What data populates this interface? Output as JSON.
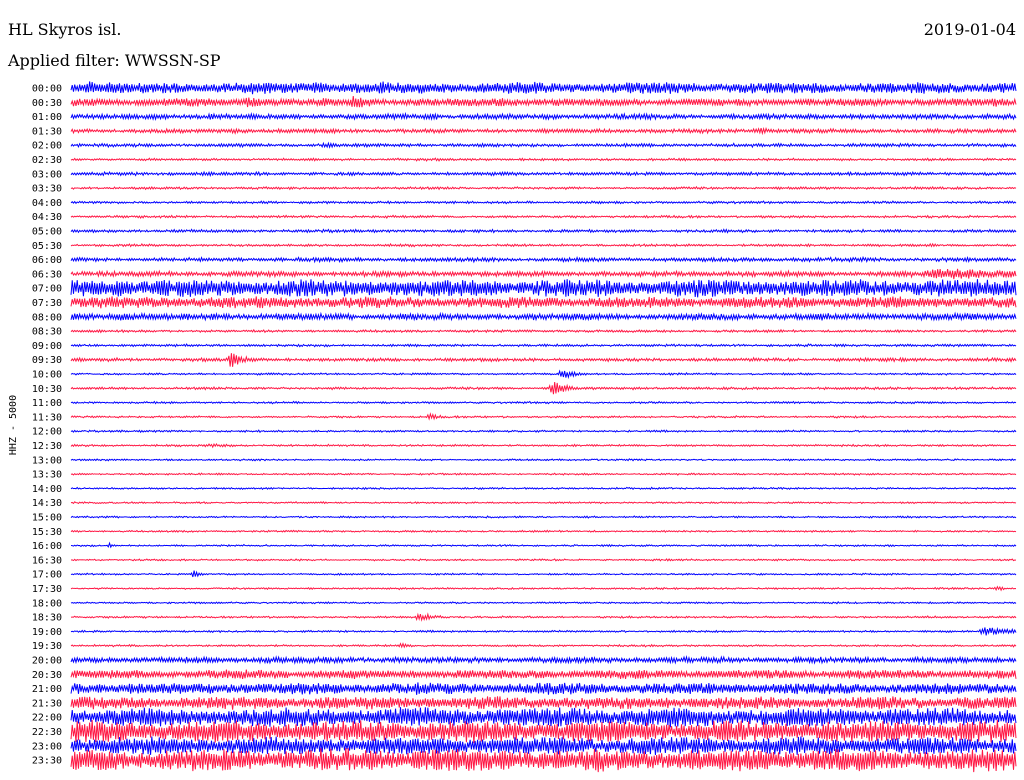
{
  "header": {
    "station": "HL Skyros isl.",
    "date": "2019-01-04",
    "filter": "Applied filter: WWSSN-SP"
  },
  "chart_data": {
    "type": "line",
    "title": "HL Skyros isl.",
    "subtitle": "Applied filter: WWSSN-SP",
    "date": "2019-01-04",
    "ylabel": "HHZ - 5000",
    "colors": [
      "#0000ff",
      "#ff1744"
    ],
    "rows": [
      {
        "label": "00:00",
        "amplitude": 0.45,
        "events": [
          {
            "at": 0.02,
            "amp": 0.7,
            "dur": 0.03
          },
          {
            "at": 0.26,
            "amp": 0.55,
            "dur": 0.05
          },
          {
            "at": 0.33,
            "amp": 0.6,
            "dur": 0.05
          }
        ]
      },
      {
        "label": "00:30",
        "amplitude": 0.3,
        "events": [
          {
            "at": 0.19,
            "amp": 0.45,
            "dur": 0.04
          },
          {
            "at": 0.3,
            "amp": 0.6,
            "dur": 0.03
          },
          {
            "at": 0.45,
            "amp": 0.45,
            "dur": 0.06
          },
          {
            "at": 0.98,
            "amp": 0.45,
            "dur": 0.03
          }
        ]
      },
      {
        "label": "01:00",
        "amplitude": 0.2,
        "events": [
          {
            "at": 0.15,
            "amp": 0.3,
            "dur": 0.03
          },
          {
            "at": 0.38,
            "amp": 0.3,
            "dur": 0.03
          }
        ]
      },
      {
        "label": "01:30",
        "amplitude": 0.15,
        "events": [
          {
            "at": 0.17,
            "amp": 0.25,
            "dur": 0.03
          },
          {
            "at": 0.73,
            "amp": 0.25,
            "dur": 0.04
          }
        ]
      },
      {
        "label": "02:00",
        "amplitude": 0.12,
        "events": [
          {
            "at": 0.27,
            "amp": 0.2,
            "dur": 0.04
          }
        ]
      },
      {
        "label": "02:30",
        "amplitude": 0.08,
        "events": []
      },
      {
        "label": "03:00",
        "amplitude": 0.12,
        "events": [
          {
            "at": 0.14,
            "amp": 0.2,
            "dur": 0.03
          }
        ]
      },
      {
        "label": "03:30",
        "amplitude": 0.08,
        "events": []
      },
      {
        "label": "04:00",
        "amplitude": 0.08,
        "events": []
      },
      {
        "label": "04:30",
        "amplitude": 0.08,
        "events": []
      },
      {
        "label": "05:00",
        "amplitude": 0.1,
        "events": []
      },
      {
        "label": "05:30",
        "amplitude": 0.08,
        "events": [
          {
            "at": 0.91,
            "amp": 0.35,
            "dur": 0.004
          }
        ]
      },
      {
        "label": "06:00",
        "amplitude": 0.15,
        "events": [
          {
            "at": 0.42,
            "amp": 0.2,
            "dur": 0.05
          }
        ]
      },
      {
        "label": "06:30",
        "amplitude": 0.2,
        "events": [
          {
            "at": 0.93,
            "amp": 0.55,
            "dur": 0.1
          }
        ]
      },
      {
        "label": "07:00",
        "amplitude": 0.7,
        "events": [
          {
            "at": 0.05,
            "amp": 0.8,
            "dur": 0.06
          }
        ]
      },
      {
        "label": "07:30",
        "amplitude": 0.45,
        "events": []
      },
      {
        "label": "08:00",
        "amplitude": 0.25,
        "events": [
          {
            "at": 0.05,
            "amp": 0.4,
            "dur": 0.05
          }
        ]
      },
      {
        "label": "08:30",
        "amplitude": 0.08,
        "events": []
      },
      {
        "label": "09:00",
        "amplitude": 0.08,
        "events": []
      },
      {
        "label": "09:30",
        "amplitude": 0.12,
        "events": [
          {
            "at": 0.17,
            "amp": 0.8,
            "dur": 0.012
          }
        ]
      },
      {
        "label": "10:00",
        "amplitude": 0.06,
        "events": [
          {
            "at": 0.52,
            "amp": 0.55,
            "dur": 0.012
          }
        ]
      },
      {
        "label": "10:30",
        "amplitude": 0.08,
        "events": [
          {
            "at": 0.51,
            "amp": 0.7,
            "dur": 0.015
          }
        ]
      },
      {
        "label": "11:00",
        "amplitude": 0.06,
        "events": []
      },
      {
        "label": "11:30",
        "amplitude": 0.06,
        "events": [
          {
            "at": 0.38,
            "amp": 0.3,
            "dur": 0.012
          }
        ]
      },
      {
        "label": "12:00",
        "amplitude": 0.06,
        "events": []
      },
      {
        "label": "12:30",
        "amplitude": 0.06,
        "events": [
          {
            "at": 0.15,
            "amp": 0.2,
            "dur": 0.02
          }
        ]
      },
      {
        "label": "13:00",
        "amplitude": 0.05,
        "events": []
      },
      {
        "label": "13:30",
        "amplitude": 0.05,
        "events": []
      },
      {
        "label": "14:00",
        "amplitude": 0.05,
        "events": []
      },
      {
        "label": "14:30",
        "amplitude": 0.05,
        "events": []
      },
      {
        "label": "15:00",
        "amplitude": 0.05,
        "events": []
      },
      {
        "label": "15:30",
        "amplitude": 0.05,
        "events": []
      },
      {
        "label": "16:00",
        "amplitude": 0.05,
        "events": [
          {
            "at": 0.04,
            "amp": 0.25,
            "dur": 0.006
          }
        ]
      },
      {
        "label": "16:30",
        "amplitude": 0.05,
        "events": []
      },
      {
        "label": "17:00",
        "amplitude": 0.05,
        "events": [
          {
            "at": 0.13,
            "amp": 0.35,
            "dur": 0.008
          }
        ]
      },
      {
        "label": "17:30",
        "amplitude": 0.05,
        "events": [
          {
            "at": 0.98,
            "amp": 0.2,
            "dur": 0.01
          }
        ]
      },
      {
        "label": "18:00",
        "amplitude": 0.05,
        "events": []
      },
      {
        "label": "18:30",
        "amplitude": 0.06,
        "events": [
          {
            "at": 0.37,
            "amp": 0.35,
            "dur": 0.02
          }
        ]
      },
      {
        "label": "19:00",
        "amplitude": 0.06,
        "events": [
          {
            "at": 0.97,
            "amp": 0.4,
            "dur": 0.03
          }
        ]
      },
      {
        "label": "19:30",
        "amplitude": 0.06,
        "events": [
          {
            "at": 0.35,
            "amp": 0.2,
            "dur": 0.01
          }
        ]
      },
      {
        "label": "20:00",
        "amplitude": 0.22,
        "events": [
          {
            "at": 0.21,
            "amp": 0.3,
            "dur": 0.08
          }
        ]
      },
      {
        "label": "20:30",
        "amplitude": 0.35,
        "events": []
      },
      {
        "label": "21:00",
        "amplitude": 0.45,
        "events": []
      },
      {
        "label": "21:30",
        "amplitude": 0.5,
        "events": []
      },
      {
        "label": "22:00",
        "amplitude": 0.75,
        "events": []
      },
      {
        "label": "22:30",
        "amplitude": 0.85,
        "events": []
      },
      {
        "label": "23:00",
        "amplitude": 0.7,
        "events": []
      },
      {
        "label": "23:30",
        "amplitude": 0.9,
        "events": [
          {
            "at": 0.95,
            "amp": 1.0,
            "dur": 0.04
          }
        ]
      }
    ]
  }
}
